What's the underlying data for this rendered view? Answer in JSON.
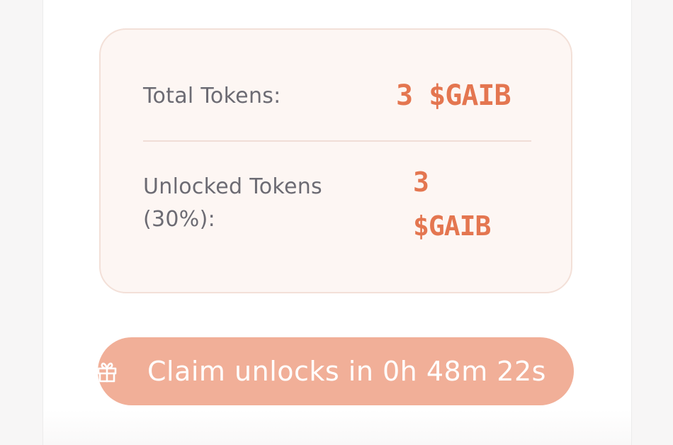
{
  "summary": {
    "total_label": "Total Tokens:",
    "total_value": "3 $GAIB",
    "unlocked_label_line1": "Unlocked Tokens",
    "unlocked_label_line2": "(30%):",
    "unlocked_value_line1": "3",
    "unlocked_value_line2": "$GAIB"
  },
  "claim_button": {
    "icon": "gift-icon",
    "label": "Claim unlocks in 0h 48m 22s"
  },
  "colors": {
    "accent": "#e47650",
    "button": "#f1af98",
    "card_bg": "#fdf6f3",
    "label_text": "#6c6b73"
  }
}
